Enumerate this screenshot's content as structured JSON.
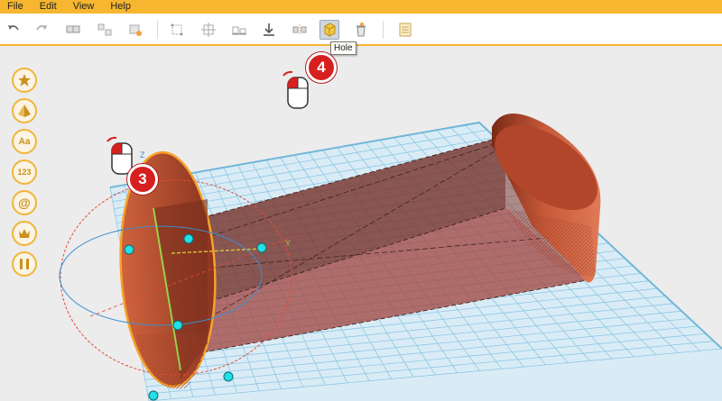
{
  "menu": {
    "items": [
      "File",
      "Edit",
      "View",
      "Help"
    ]
  },
  "toolbar": {
    "buttons": [
      "undo-icon",
      "redo-icon",
      "group-icon",
      "ungroup-icon",
      "merge-icon",
      "align-icon",
      "distribute-icon",
      "lay-flat-icon",
      "download-icon",
      "mirror-icon",
      "hole-icon",
      "recycle-bin-icon",
      "notes-icon"
    ],
    "tooltip": "Hole"
  },
  "sidebar": {
    "items": [
      {
        "name": "star-shapes",
        "icon": "star-icon",
        "label": ""
      },
      {
        "name": "basic-shapes",
        "icon": "pyramid-icon",
        "label": ""
      },
      {
        "name": "text",
        "icon": "text-icon",
        "label": "Aa"
      },
      {
        "name": "numbers",
        "icon": "numbers-icon",
        "label": "123"
      },
      {
        "name": "symbols",
        "icon": "at-icon",
        "label": "@"
      },
      {
        "name": "crown",
        "icon": "crown-icon",
        "label": ""
      },
      {
        "name": "tools",
        "icon": "tools-icon",
        "label": ""
      }
    ]
  },
  "steps": {
    "step3": "3",
    "step4": "4"
  },
  "axis": {
    "y_label": "Y",
    "z_label": "Z"
  },
  "colors": {
    "accent": "#f6b62f",
    "badge": "#d62020",
    "shape": "#b34a2a",
    "grid": "#8ec7e3"
  }
}
